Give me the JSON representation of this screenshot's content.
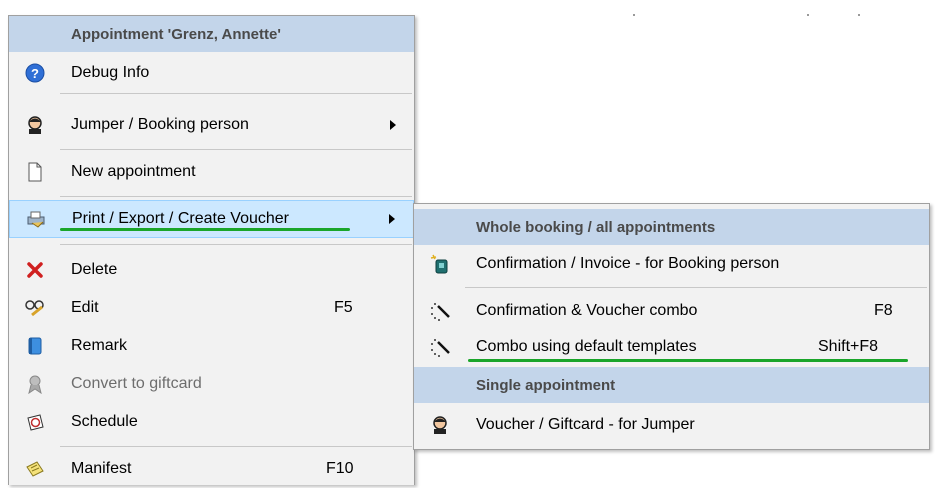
{
  "main_menu": {
    "header": "Appointment 'Grenz, Annette'",
    "items": [
      {
        "label": "Debug Info",
        "icon": "help-icon"
      },
      {
        "label": "Jumper / Booking person",
        "icon": "person-icon",
        "submenu": true
      },
      {
        "label": "New appointment",
        "icon": "document-icon"
      },
      {
        "label": "Print / Export / Create Voucher",
        "icon": "printer-icon",
        "submenu": true,
        "highlighted": true
      },
      {
        "label": "Delete",
        "icon": "delete-x-icon"
      },
      {
        "label": "Edit",
        "icon": "edit-glasses-icon",
        "shortcut": "F5"
      },
      {
        "label": "Remark",
        "icon": "notebook-icon"
      },
      {
        "label": "Convert to giftcard",
        "icon": "ribbon-icon",
        "disabled": true
      },
      {
        "label": "Schedule",
        "icon": "schedule-icon"
      },
      {
        "label": "Manifest",
        "icon": "manifest-icon",
        "shortcut": "F10"
      }
    ]
  },
  "sub_menu": {
    "header_whole": "Whole booking / all appointments",
    "items_whole": [
      {
        "label": "Confirmation / Invoice - for Booking person",
        "icon": "new-notebook-icon"
      },
      {
        "label": "Confirmation & Voucher combo",
        "icon": "magic-wand-icon",
        "shortcut": "F8"
      },
      {
        "label": "Combo using default templates",
        "icon": "magic-wand-icon",
        "shortcut": "Shift+F8"
      }
    ],
    "header_single": "Single appointment",
    "items_single": [
      {
        "label": "Voucher / Giftcard - for Jumper",
        "icon": "person-icon"
      }
    ]
  },
  "colors": {
    "menu_bg": "#f2f2f2",
    "header_bg": "#c3d5ea",
    "highlight_bg": "#cce8ff",
    "annotation_line": "#1aa52a"
  }
}
